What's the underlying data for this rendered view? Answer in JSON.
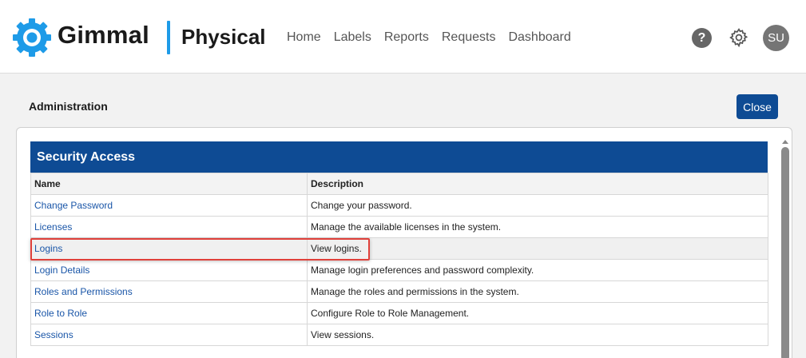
{
  "header": {
    "brand": "Gimmal",
    "product": "Physical",
    "nav": [
      "Home",
      "Labels",
      "Reports",
      "Requests",
      "Dashboard"
    ],
    "help_glyph": "?",
    "avatar_initials": "SU",
    "accent_color": "#1e9be8",
    "icons": {
      "logo": "gear-logo-icon",
      "help": "help-icon",
      "settings": "gear-icon"
    }
  },
  "page": {
    "title": "Administration",
    "close_label": "Close",
    "primary_color": "#0e4b94"
  },
  "section": {
    "title": "Security Access",
    "columns": {
      "name": "Name",
      "description": "Description"
    },
    "rows": [
      {
        "name": "Change Password",
        "description": "Change your password."
      },
      {
        "name": "Licenses",
        "description": "Manage the available licenses in the system."
      },
      {
        "name": "Logins",
        "description": "View logins."
      },
      {
        "name": "Login Details",
        "description": "Manage login preferences and password complexity."
      },
      {
        "name": "Roles and Permissions",
        "description": "Manage the roles and permissions in the system."
      },
      {
        "name": "Role to Role",
        "description": "Configure Role to Role Management."
      },
      {
        "name": "Sessions",
        "description": "View sessions."
      }
    ],
    "highlighted_row": "Logins",
    "highlight_color": "#e0403a"
  }
}
